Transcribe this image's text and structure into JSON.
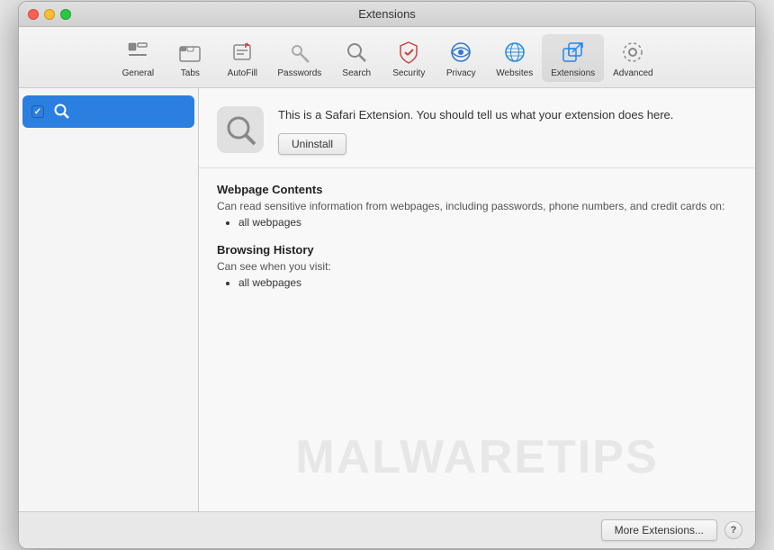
{
  "window": {
    "title": "Extensions"
  },
  "titlebar": {
    "title": "Extensions"
  },
  "toolbar": {
    "items": [
      {
        "id": "general",
        "label": "General",
        "icon": "general"
      },
      {
        "id": "tabs",
        "label": "Tabs",
        "icon": "tabs"
      },
      {
        "id": "autofill",
        "label": "AutoFill",
        "icon": "autofill"
      },
      {
        "id": "passwords",
        "label": "Passwords",
        "icon": "passwords"
      },
      {
        "id": "search",
        "label": "Search",
        "icon": "search"
      },
      {
        "id": "security",
        "label": "Security",
        "icon": "security"
      },
      {
        "id": "privacy",
        "label": "Privacy",
        "icon": "privacy"
      },
      {
        "id": "websites",
        "label": "Websites",
        "icon": "websites"
      },
      {
        "id": "extensions",
        "label": "Extensions",
        "icon": "extensions",
        "active": true
      },
      {
        "id": "advanced",
        "label": "Advanced",
        "icon": "advanced"
      }
    ]
  },
  "sidebar": {
    "items": [
      {
        "id": "search-ext",
        "label": "Search",
        "enabled": true,
        "selected": true
      }
    ]
  },
  "extension_detail": {
    "description": "This is a Safari Extension. You should tell us what your extension does here.",
    "uninstall_label": "Uninstall",
    "permissions": [
      {
        "title": "Webpage Contents",
        "description": "Can read sensitive information from webpages, including passwords, phone numbers, and credit cards on:",
        "items": [
          "all webpages"
        ]
      },
      {
        "title": "Browsing History",
        "description": "Can see when you visit:",
        "items": [
          "all webpages"
        ]
      }
    ]
  },
  "footer": {
    "more_extensions_label": "More Extensions...",
    "help_label": "?"
  },
  "watermark": {
    "text": "MALWARETIPS"
  }
}
